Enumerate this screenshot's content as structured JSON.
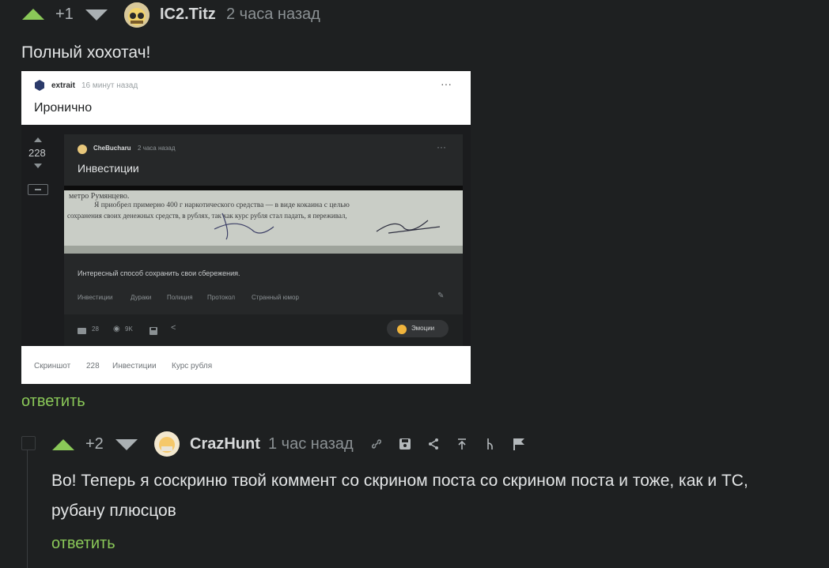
{
  "comment1": {
    "score": "+1",
    "username": "IC2.Titz",
    "time": "2 часа назад",
    "text": "Полный хохотач!",
    "reply_label": "ответить"
  },
  "screenshot": {
    "top_user": "extrait",
    "top_time": "16 минут назад",
    "top_title": "Иронично",
    "inner_score": "228",
    "inner_user": "CheBucharu",
    "inner_time": "2 часа назад",
    "inner_title": "Инвестиции",
    "photo_lines": [
      "метро Румянцево.",
      "Я приобрел примерно 400 г наркотического средства — в виде кокаина с целью",
      "сохранения своих денежных средств, в рублях, так как курс рубля стал падать, я переживал,"
    ],
    "inner_text": "Интересный способ сохранить свои сбережения.",
    "inner_tags": [
      "Инвестиции",
      "Дураки",
      "Полиция",
      "Протокол",
      "Странный юмор"
    ],
    "inner_comments": "28",
    "inner_views": "9K",
    "emotions_label": "Эмоции",
    "bottom_tags": [
      "Скриншот",
      "228",
      "Инвестиции",
      "Курс рубля"
    ]
  },
  "comment2": {
    "score": "+2",
    "username": "CrazHunt",
    "time": "1 час назад",
    "text_line1": "Во! Теперь я соскриню твой коммент со скрином поста со скрином поста и тоже, как и ТС,",
    "text_line2": "рубану плюсцов",
    "reply_label": "ответить"
  },
  "colors": {
    "background": "#1e2021",
    "accent_green": "#8ac858",
    "text": "#d7d9da",
    "muted": "#8b9194"
  }
}
